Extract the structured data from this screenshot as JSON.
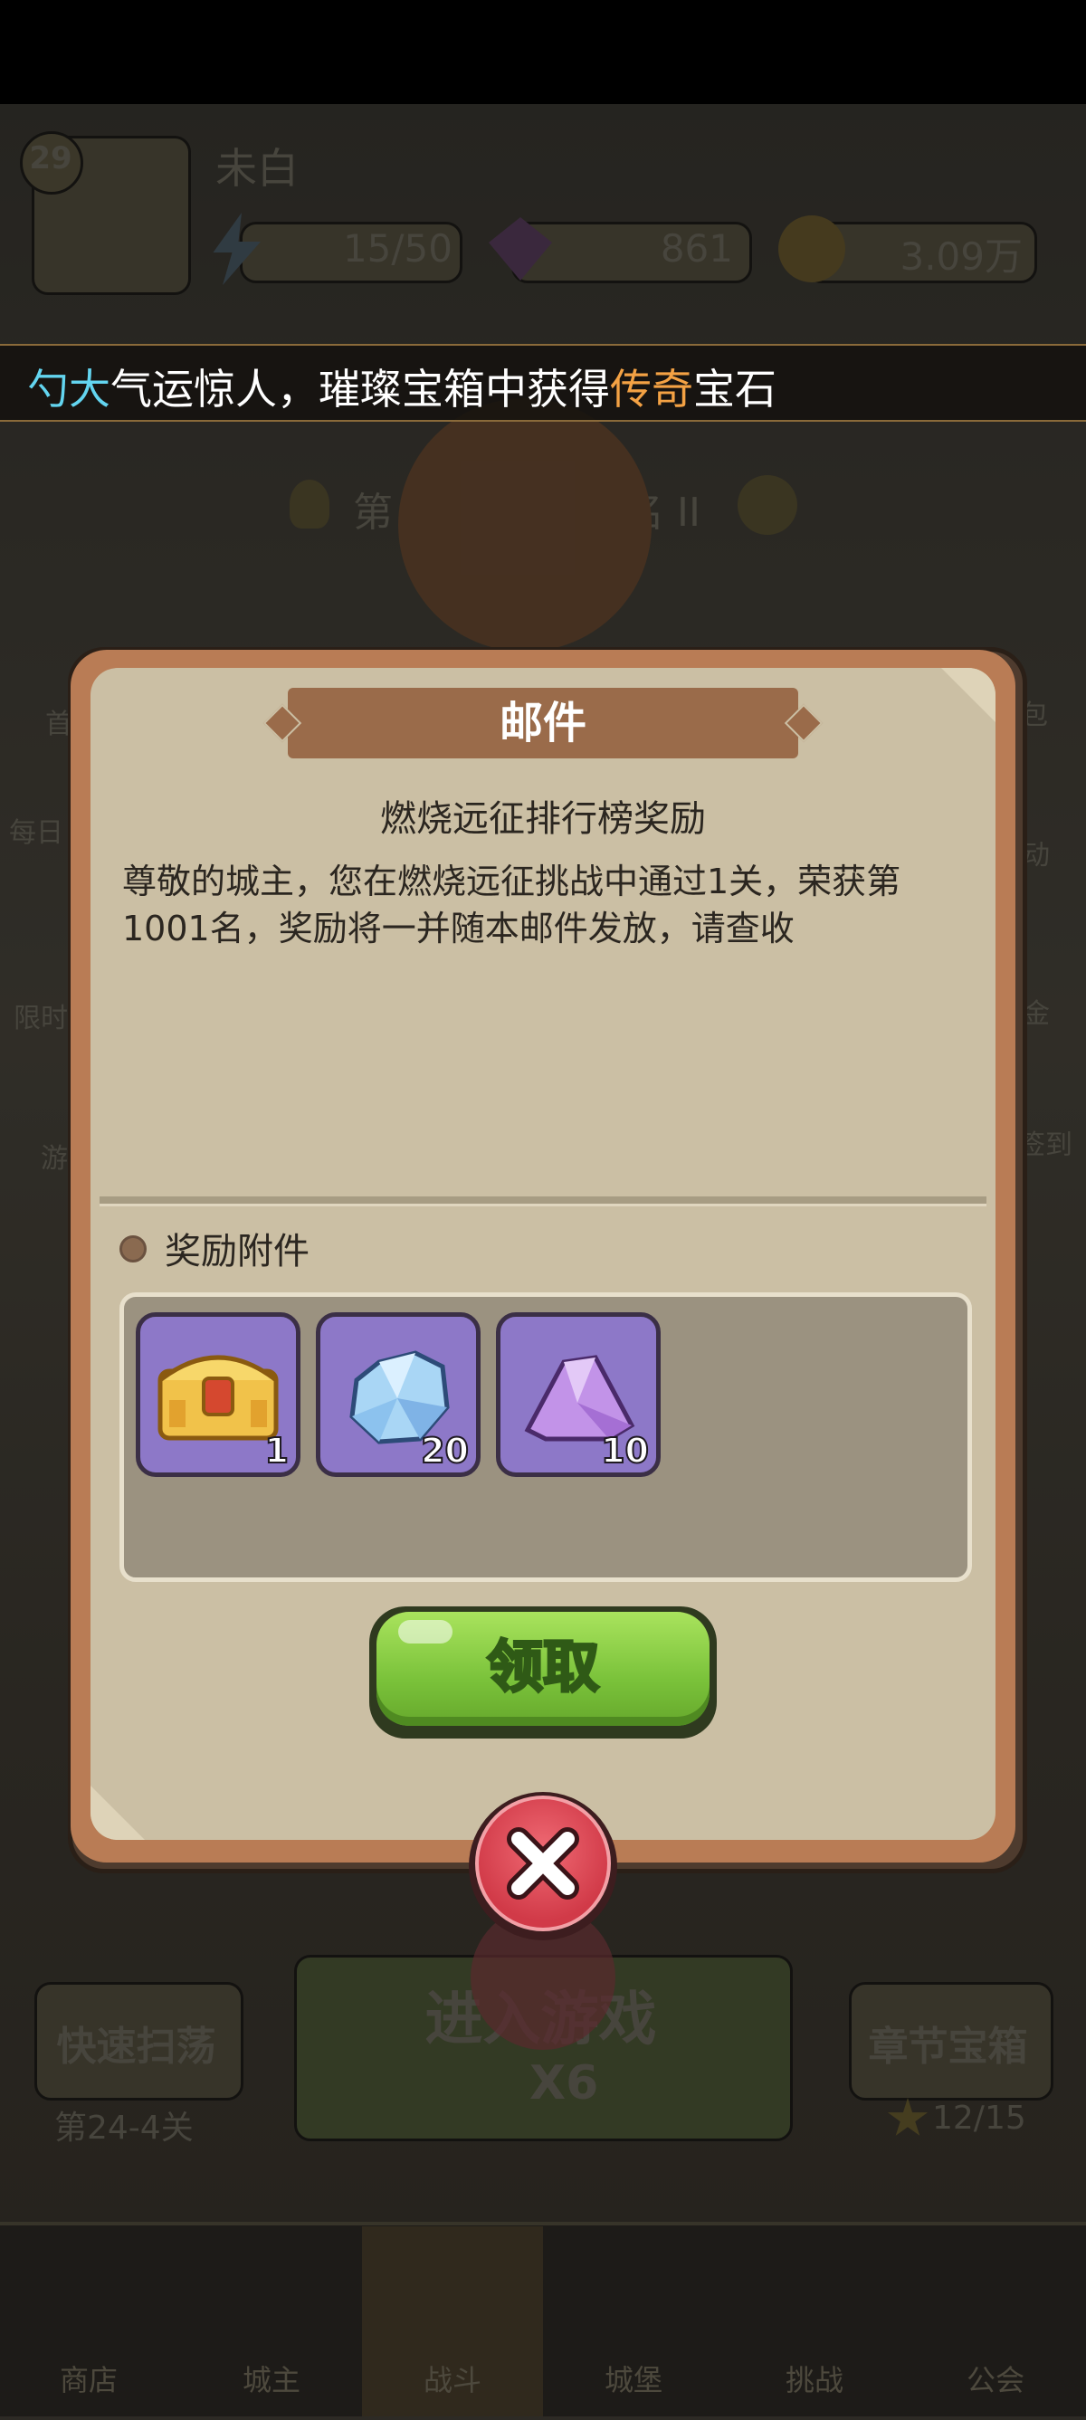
{
  "player": {
    "level": "29",
    "name": "未白",
    "stamina": "15/50",
    "gems": "861",
    "gold": "3.09万"
  },
  "marquee": {
    "prefix": "勺",
    "highlight_a": "大",
    "mid": "气运惊人，璀璨宝箱中获得",
    "highlight_b": "传奇",
    "suffix": "宝石"
  },
  "background": {
    "left_menu": [
      "首",
      "每日",
      "限时",
      "游"
    ],
    "right_menu": [
      "包",
      "动",
      "金",
      "签到"
    ],
    "quick_sweep": "快速扫荡",
    "stage": "第24-4关",
    "enter_game": "进入游戏",
    "energy_cost": "X6",
    "chapter_chest": "章节宝箱",
    "stars": "12/15",
    "chapter_hint_left": "第",
    "chapter_hint_right": "名 II"
  },
  "mail_dialog": {
    "title": "邮件",
    "subject": "燃烧远征排行榜奖励",
    "body": "尊敬的城主，您在燃烧远征挑战中通过1关，荣获第1001名，奖励将一并随本邮件发放，请查收",
    "attachments_label": "奖励附件",
    "items": [
      {
        "icon": "golden-chest-icon",
        "qty": "1"
      },
      {
        "icon": "blue-crystal-icon",
        "qty": "20"
      },
      {
        "icon": "purple-gem-icon",
        "qty": "10"
      }
    ],
    "claim_label": "领取",
    "close_icon": "close-x-icon"
  },
  "nav": [
    "商店",
    "城主",
    "战斗",
    "城堡",
    "挑战",
    "公会"
  ],
  "colors": {
    "accent_cyan": "#63d5f0",
    "accent_orange": "#f4a244",
    "claim_green": "#7ac23a",
    "close_red": "#d13a48",
    "item_bg": "#8d78c8"
  }
}
